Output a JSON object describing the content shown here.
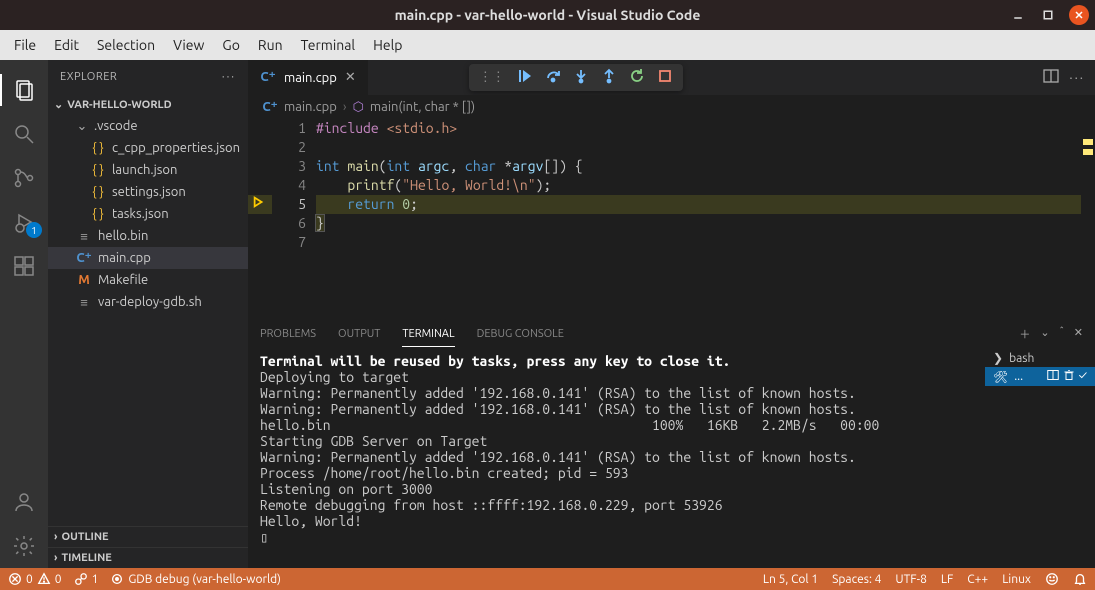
{
  "window": {
    "title": "main.cpp - var-hello-world - Visual Studio Code"
  },
  "menubar": [
    "File",
    "Edit",
    "Selection",
    "View",
    "Go",
    "Run",
    "Terminal",
    "Help"
  ],
  "sidebar": {
    "header": "EXPLORER",
    "project": "VAR-HELLO-WORLD",
    "folder_vscode": ".vscode",
    "files_vscode": [
      "c_cpp_properties.json",
      "launch.json",
      "settings.json",
      "tasks.json"
    ],
    "files_root": [
      {
        "name": "hello.bin",
        "icon": "bin"
      },
      {
        "name": "main.cpp",
        "icon": "cpp",
        "selected": true
      },
      {
        "name": "Makefile",
        "icon": "make"
      },
      {
        "name": "var-deploy-gdb.sh",
        "icon": "sh"
      }
    ],
    "outline": "OUTLINE",
    "timeline": "TIMELINE",
    "debug_badge": "1"
  },
  "tabs": {
    "active": "main.cpp"
  },
  "breadcrumb": {
    "file": "main.cpp",
    "symbol": "main(int, char * [])"
  },
  "editor": {
    "lines": [
      {
        "n": 1,
        "html": "<span class='tok-inc'>#include</span> <span class='tok-str'>&lt;stdio.h&gt;</span>"
      },
      {
        "n": 2,
        "html": ""
      },
      {
        "n": 3,
        "html": "<span class='tok-type'>int</span> <span class='tok-fn'>main</span>(<span class='tok-type'>int</span> <span class='tok-var'>argc</span>, <span class='tok-type'>char</span> *<span class='tok-var'>argv</span>[]) {"
      },
      {
        "n": 4,
        "html": "    <span class='tok-fn'>printf</span>(<span class='tok-str'>\"Hello, World!\\n\"</span>);"
      },
      {
        "n": 5,
        "html": "    <span class='tok-kw'>return</span> <span class='tok-num'>0</span>;",
        "current": true
      },
      {
        "n": 6,
        "html": "}",
        "hlclose": true
      },
      {
        "n": 7,
        "html": ""
      }
    ]
  },
  "panel": {
    "tabs": [
      "PROBLEMS",
      "OUTPUT",
      "TERMINAL",
      "DEBUG CONSOLE"
    ],
    "active": "TERMINAL",
    "terminal_bold": "Terminal will be reused by tasks, press any key to close it.",
    "terminal_lines": [
      "",
      "Deploying to target",
      "Warning: Permanently added '192.168.0.141' (RSA) to the list of known hosts.",
      "Warning: Permanently added '192.168.0.141' (RSA) to the list of known hosts.",
      "hello.bin                                         100%   16KB   2.2MB/s   00:00",
      "Starting GDB Server on Target",
      "Warning: Permanently added '192.168.0.141' (RSA) to the list of known hosts.",
      "Process /home/root/hello.bin created; pid = 593",
      "Listening on port 3000",
      "Remote debugging from host ::ffff:192.168.0.229, port 53926",
      "Hello, World!",
      "▯"
    ],
    "term_sidebar": [
      {
        "label": "bash"
      },
      {
        "label": "...",
        "active": true
      }
    ]
  },
  "status": {
    "errors": "0",
    "warnings": "0",
    "ports": "1",
    "debug_conf": "GDB debug (var-hello-world)",
    "lncol": "Ln 5, Col 1",
    "spaces": "Spaces: 4",
    "encoding": "UTF-8",
    "eol": "LF",
    "lang": "C++",
    "os": "Linux"
  }
}
